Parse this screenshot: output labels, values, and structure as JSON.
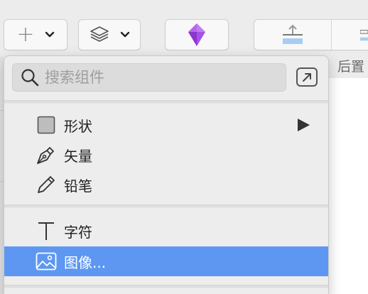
{
  "toolbar": {
    "insert": {
      "icon": "plus-icon",
      "chevron": "chevron-down-icon"
    },
    "layers": {
      "icon": "layers-icon",
      "chevron": "chevron-down-icon"
    },
    "symbol": {
      "icon": "diamond-icon",
      "color": "#9b4be0"
    },
    "align": {
      "icon": "align-bottom-icon"
    },
    "label_partial": "后置"
  },
  "menu": {
    "search": {
      "placeholder": "搜索组件",
      "value": ""
    },
    "popout": {
      "icon": "popout-arrow-icon"
    },
    "items": [
      {
        "label": "形状",
        "icon": "square-icon",
        "submenu": true
      },
      {
        "label": "矢量",
        "icon": "pen-nib-icon",
        "submenu": false
      },
      {
        "label": "铅笔",
        "icon": "pencil-icon",
        "submenu": false
      },
      {
        "label": "字符",
        "icon": "text-cursor-icon",
        "submenu": false
      },
      {
        "label": "图像...",
        "icon": "image-icon",
        "submenu": false,
        "selected": true
      }
    ]
  },
  "colors": {
    "selection": "#5e97f1",
    "menu_background": "#ededed",
    "symbol_gem": "#9b4be0",
    "align_blue": "#a9cdf2"
  }
}
